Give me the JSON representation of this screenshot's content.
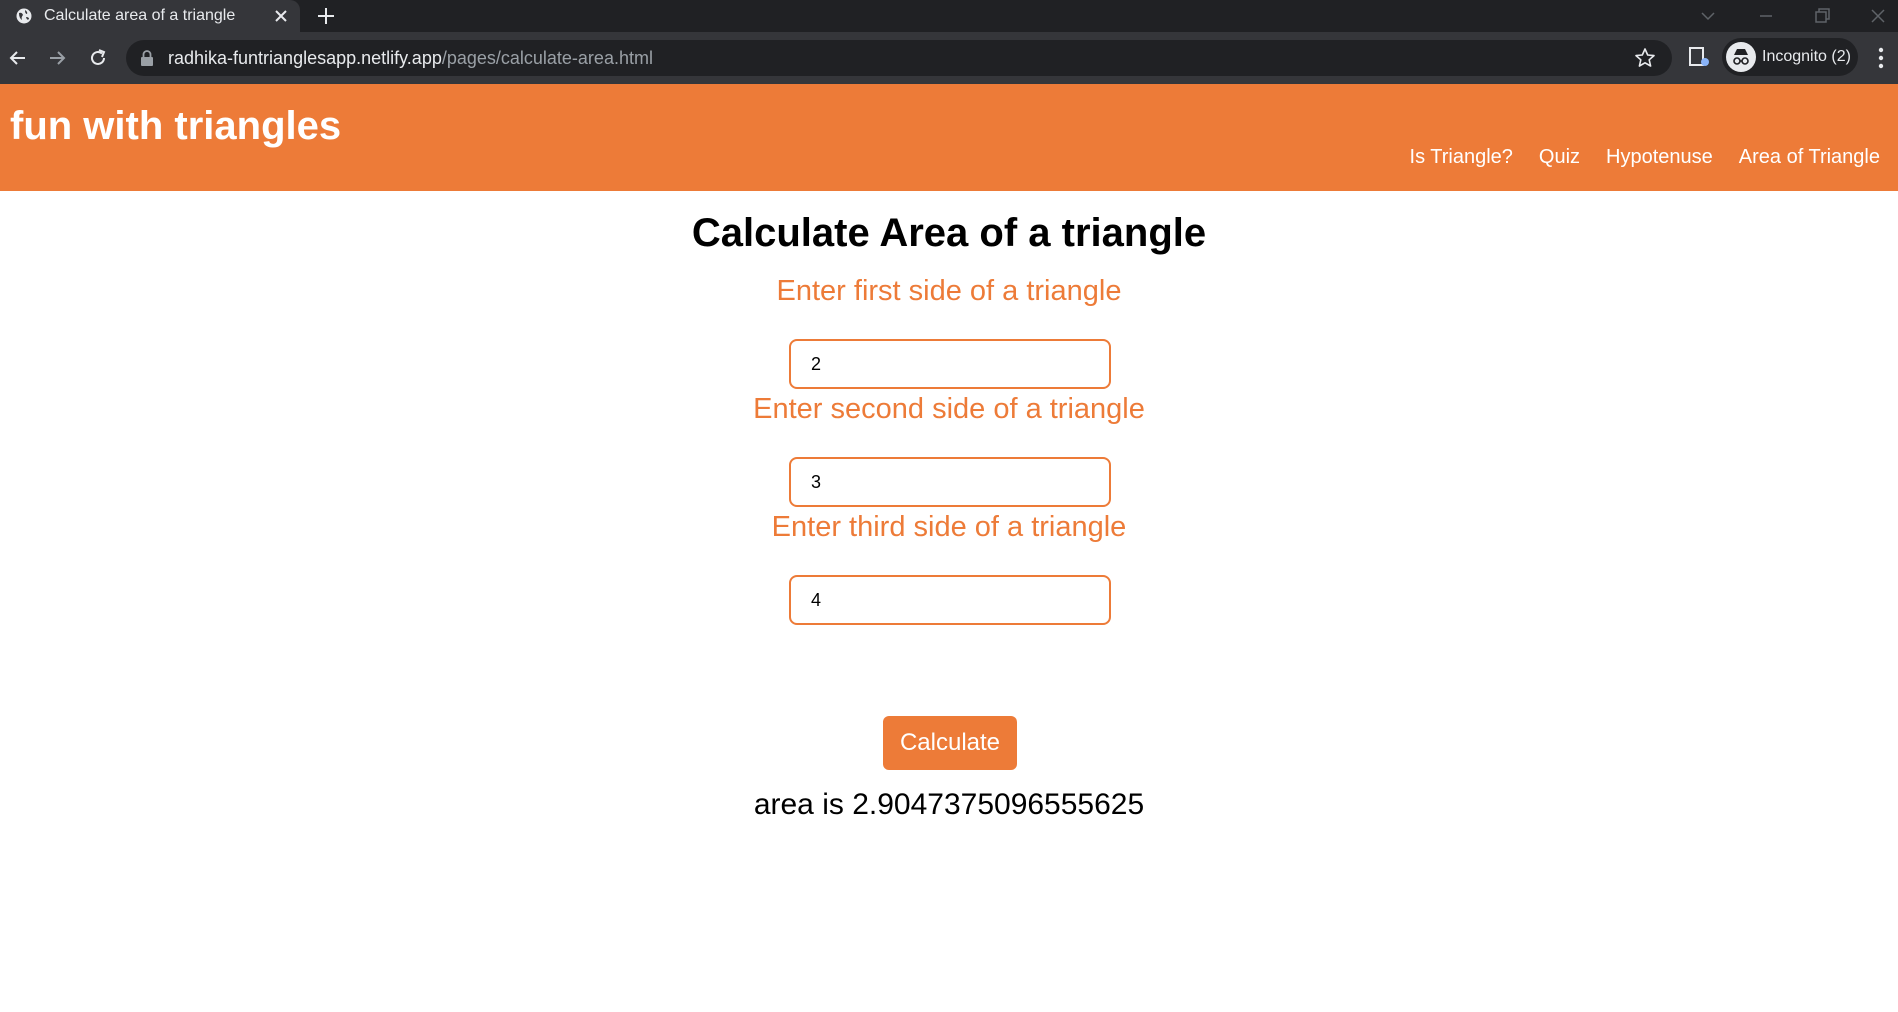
{
  "browser": {
    "tab_title": "Calculate area of a triangle",
    "url_host": "radhika-funtrianglesapp.netlify.app",
    "url_path": "/pages/calculate-area.html",
    "incognito_label": "Incognito (2)"
  },
  "header": {
    "title": "fun with triangles",
    "nav": [
      "Is Triangle?",
      "Quiz",
      "Hypotenuse",
      "Area of Triangle"
    ]
  },
  "main": {
    "heading": "Calculate Area of a triangle",
    "fields": [
      {
        "label": "Enter first side of a triangle",
        "value": "2"
      },
      {
        "label": "Enter second side of a triangle",
        "value": "3"
      },
      {
        "label": "Enter third side of a triangle",
        "value": "4"
      }
    ],
    "button_label": "Calculate",
    "output": "area is 2.9047375096555625"
  },
  "colors": {
    "accent": "#ed7b38",
    "chrome_dark": "#202124",
    "chrome_tab": "#35363a"
  }
}
